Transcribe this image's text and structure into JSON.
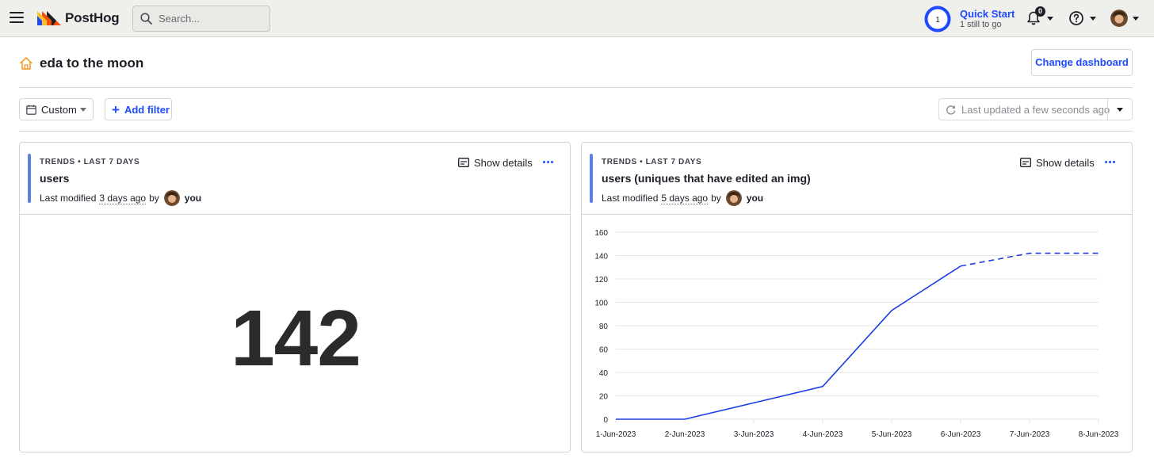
{
  "topbar": {
    "brand": "PostHog",
    "search_placeholder": "Search...",
    "quickstart": {
      "step": "1",
      "title": "Quick Start",
      "subtitle": "1 still to go"
    },
    "notifications_count": "0"
  },
  "page": {
    "title": "eda to the moon",
    "change_dashboard_label": "Change dashboard"
  },
  "filters": {
    "date_label": "Custom",
    "add_filter_label": "Add filter",
    "last_updated": "Last updated a few seconds ago"
  },
  "cards": [
    {
      "tag": "TRENDS • LAST 7 DAYS",
      "title": "users",
      "modified_prefix": "Last modified",
      "modified_ago": "3 days ago",
      "modified_by": "by",
      "author": "you",
      "show_details": "Show details",
      "value": "142"
    },
    {
      "tag": "TRENDS • LAST 7 DAYS",
      "title": "users (uniques that have edited an img)",
      "modified_prefix": "Last modified",
      "modified_ago": "5 days ago",
      "modified_by": "by",
      "author": "you",
      "show_details": "Show details"
    }
  ],
  "chart_data": {
    "type": "line",
    "categories": [
      "1-Jun-2023",
      "2-Jun-2023",
      "3-Jun-2023",
      "4-Jun-2023",
      "5-Jun-2023",
      "6-Jun-2023",
      "7-Jun-2023",
      "8-Jun-2023"
    ],
    "series": [
      {
        "values": [
          0,
          0,
          14,
          28,
          93,
          131,
          142,
          142
        ],
        "dashed_from_index": 5,
        "color": "#1d3ee6"
      }
    ],
    "ylim": [
      0,
      160
    ],
    "yticks": [
      0,
      20,
      40,
      60,
      80,
      100,
      120,
      140,
      160
    ],
    "grid": true
  },
  "colors": {
    "accent": "#1d4aff",
    "card_accent": "#5f7fe0",
    "line": "#1d3ee6"
  }
}
